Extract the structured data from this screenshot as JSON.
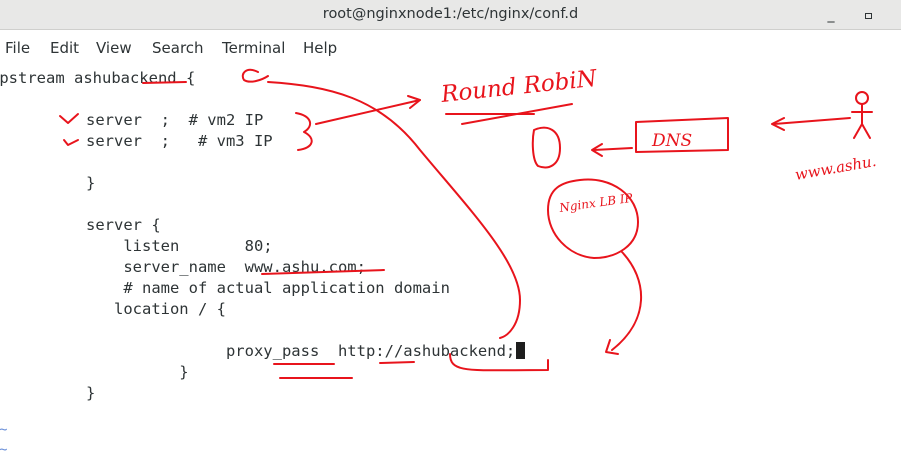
{
  "window": {
    "title": "root@nginxnode1:/etc/nginx/conf.d",
    "minimize_glyph": "_",
    "maximize_glyph": "▫"
  },
  "menu": {
    "items": [
      "File",
      "Edit",
      "View",
      "Search",
      "Terminal",
      "Help"
    ]
  },
  "terminal": {
    "lines": [
      "upstream ashubackend {",
      "",
      "      server  ;  # vm2 IP",
      "      server  ;   # vm3 IP",
      "",
      "      }",
      "",
      "      server {",
      "          listen       80;",
      "          server_name  www.ashu.com;",
      "          # name of actual application domain",
      "         location / {",
      "",
      "                     proxy_pass  http://ashubackend;",
      "                }",
      "      }"
    ],
    "empty_line_marker": "~"
  },
  "annotations": {
    "round_robin": "Round RobiN",
    "dns": "DNS",
    "nginx_lb_ip": "Nginx LB IP",
    "client_url": "www.ashu.",
    "ink_color": "#e8141c"
  }
}
